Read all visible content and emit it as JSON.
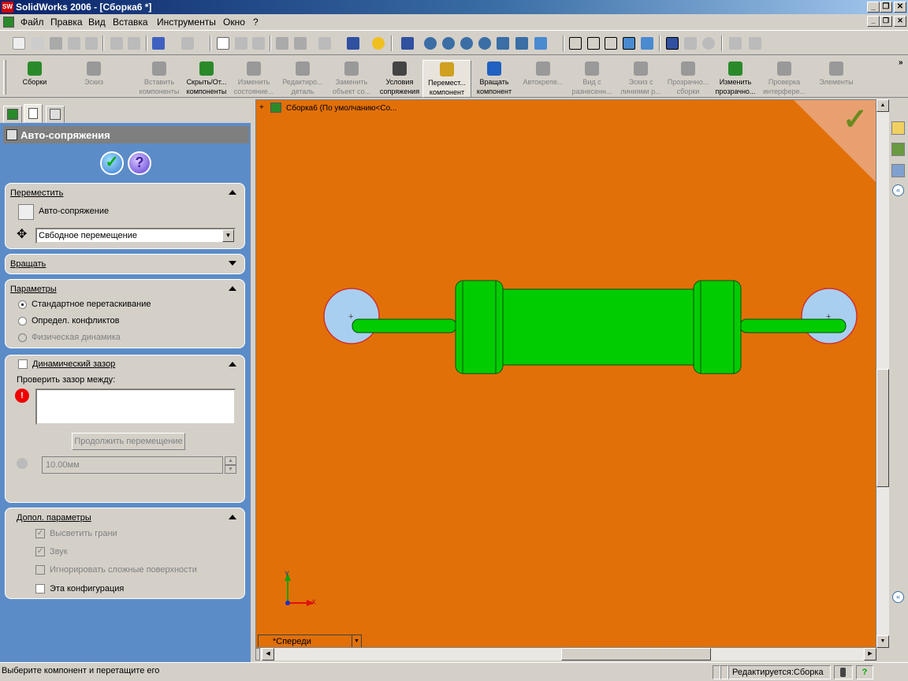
{
  "window": {
    "title": "SolidWorks 2006 - [Сборка6 *]"
  },
  "menu": {
    "items": [
      "Файл",
      "Правка",
      "Вид",
      "Вставка",
      "Инструменты",
      "Окно",
      "?"
    ]
  },
  "command_manager": {
    "items": [
      {
        "label": "Сборки",
        "enabled": true
      },
      {
        "label": "Эскиз",
        "enabled": false
      },
      {
        "label": "Вставить компоненты",
        "enabled": false
      },
      {
        "label": "Скрыть/От... компоненты",
        "enabled": true
      },
      {
        "label": "Изменить состояние...",
        "enabled": false
      },
      {
        "label": "Редактиро... деталь",
        "enabled": false
      },
      {
        "label": "Заменить объект со...",
        "enabled": false
      },
      {
        "label": "Условия сопряжения",
        "enabled": true
      },
      {
        "label": "Перемест... компонент",
        "enabled": true,
        "selected": true
      },
      {
        "label": "Вращать компонент",
        "enabled": true
      },
      {
        "label": "Автокрепе...",
        "enabled": false
      },
      {
        "label": "Вид с разнесенн...",
        "enabled": false
      },
      {
        "label": "Эскиз с линиями р...",
        "enabled": false
      },
      {
        "label": "Прозрачно... сборки",
        "enabled": false
      },
      {
        "label": "Изменить прозрачно...",
        "enabled": true
      },
      {
        "label": "Проверка интерфере...",
        "enabled": false
      },
      {
        "label": "Элементы",
        "enabled": false
      }
    ]
  },
  "property_manager": {
    "title": "Авто-сопряжения",
    "move": {
      "header": "Переместить",
      "auto_mate": "Авто-сопряжение",
      "mode_value": "Свбодное перемещение"
    },
    "rotate": {
      "header": "Вращать"
    },
    "options": {
      "header": "Параметры",
      "radio1": "Стандартное перетаскивание",
      "radio2": "Определ. конфликтов",
      "radio3": "Физическая динамика"
    },
    "clearance": {
      "header": "Динамический зазор",
      "check_between": "Проверить зазор между:",
      "resume_button": "Продолжить перемещение",
      "distance": "10.00мм"
    },
    "advanced": {
      "header": "Допол. параметры",
      "highlight_faces": "Высветить грани",
      "sound": "Звук",
      "ignore_complex": "Игнорировать сложные поверхности",
      "this_config": "Эта конфигурация"
    }
  },
  "viewport": {
    "tree_root": "Сборка6  (По умолчанию<Со...",
    "view_name": "*Спереди",
    "background_color": "#e27008",
    "part_color": "#00cc00",
    "axis_x": "X",
    "axis_y": "Y"
  },
  "status_bar": {
    "message": "Выберите компонент и перетащите его",
    "mode": "Редактируется:Сборка"
  }
}
